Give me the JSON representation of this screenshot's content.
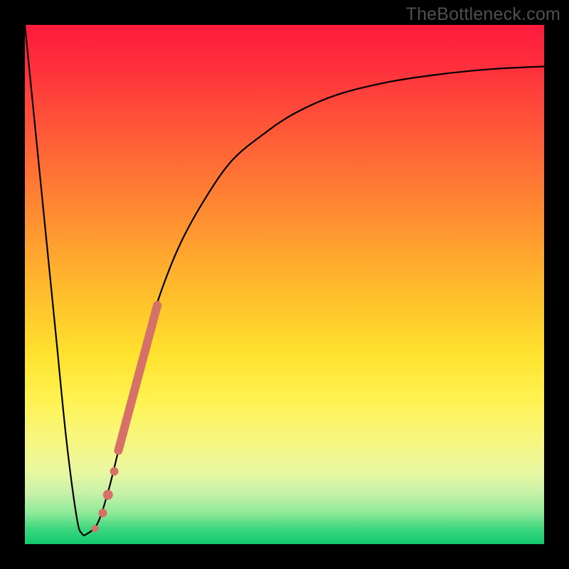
{
  "watermark": "TheBottleneck.com",
  "colors": {
    "curve_stroke": "#000000",
    "marker_fill": "#d67168",
    "gradient_top": "#ff1a3c",
    "gradient_bottom": "#11c96e"
  },
  "chart_data": {
    "type": "line",
    "title": "",
    "xlabel": "",
    "ylabel": "",
    "xlim": [
      0,
      100
    ],
    "ylim": [
      0,
      100
    ],
    "grid": false,
    "legend": false,
    "series": [
      {
        "name": "bottleneck-curve",
        "x": [
          0,
          2,
          4,
          6,
          8,
          10,
          11,
          12,
          14,
          16,
          18,
          20,
          23,
          26,
          30,
          35,
          40,
          46,
          52,
          60,
          70,
          80,
          90,
          100
        ],
        "y": [
          100,
          80,
          60,
          40,
          20,
          5,
          2,
          2,
          4,
          10,
          18,
          27,
          38,
          48,
          58,
          67,
          74,
          79,
          83,
          86.5,
          89,
          90.5,
          91.5,
          92
        ]
      }
    ],
    "markers": [
      {
        "name": "thick-segment",
        "type": "line",
        "x": [
          18,
          25.5
        ],
        "y": [
          18,
          46
        ],
        "width": 12
      },
      {
        "name": "dot-1",
        "type": "point",
        "x": 17.2,
        "y": 14.0,
        "r": 6
      },
      {
        "name": "dot-2",
        "type": "point",
        "x": 16.0,
        "y": 9.5,
        "r": 7
      },
      {
        "name": "dot-3",
        "type": "point",
        "x": 15.0,
        "y": 6.0,
        "r": 6
      },
      {
        "name": "dot-4",
        "type": "point",
        "x": 13.5,
        "y": 3.0,
        "r": 5
      }
    ]
  }
}
